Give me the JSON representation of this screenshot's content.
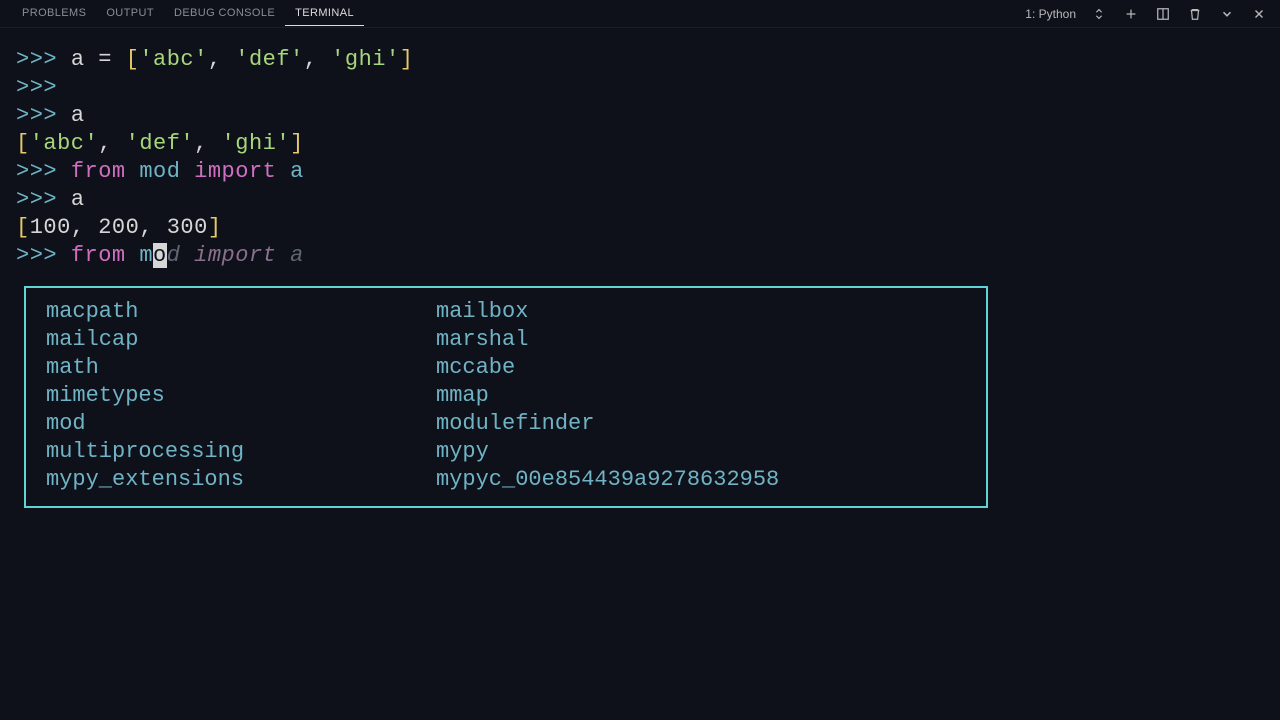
{
  "panel": {
    "tabs": [
      "PROBLEMS",
      "OUTPUT",
      "DEBUG CONSOLE",
      "TERMINAL"
    ],
    "active_tab_index": 3,
    "terminal_selector": "1: Python"
  },
  "terminal": {
    "lines": [
      {
        "type": "assign",
        "prompt": ">>>",
        "code": "a = ['abc', 'def', 'ghi']"
      },
      {
        "type": "blankprompt",
        "prompt": ">>>"
      },
      {
        "type": "expr",
        "prompt": ">>>",
        "code": "a"
      },
      {
        "type": "output",
        "text": "['abc', 'def', 'ghi']"
      },
      {
        "type": "import",
        "prompt": ">>>",
        "code": "from mod import a"
      },
      {
        "type": "expr",
        "prompt": ">>>",
        "code": "a"
      },
      {
        "type": "output",
        "text": "[100, 200, 300]"
      }
    ],
    "current": {
      "prompt": ">>>",
      "typed_before_cursor": "from m",
      "cursor_char": "o",
      "ghost_after": "d import a"
    }
  },
  "completions": {
    "col1": [
      "macpath",
      "mailcap",
      "math",
      "mimetypes",
      "mod",
      "multiprocessing",
      "mypy_extensions"
    ],
    "col2": [
      "mailbox",
      "marshal",
      "mccabe",
      "mmap",
      "modulefinder",
      "mypy",
      "mypyc_00e854439a9278632958"
    ]
  }
}
